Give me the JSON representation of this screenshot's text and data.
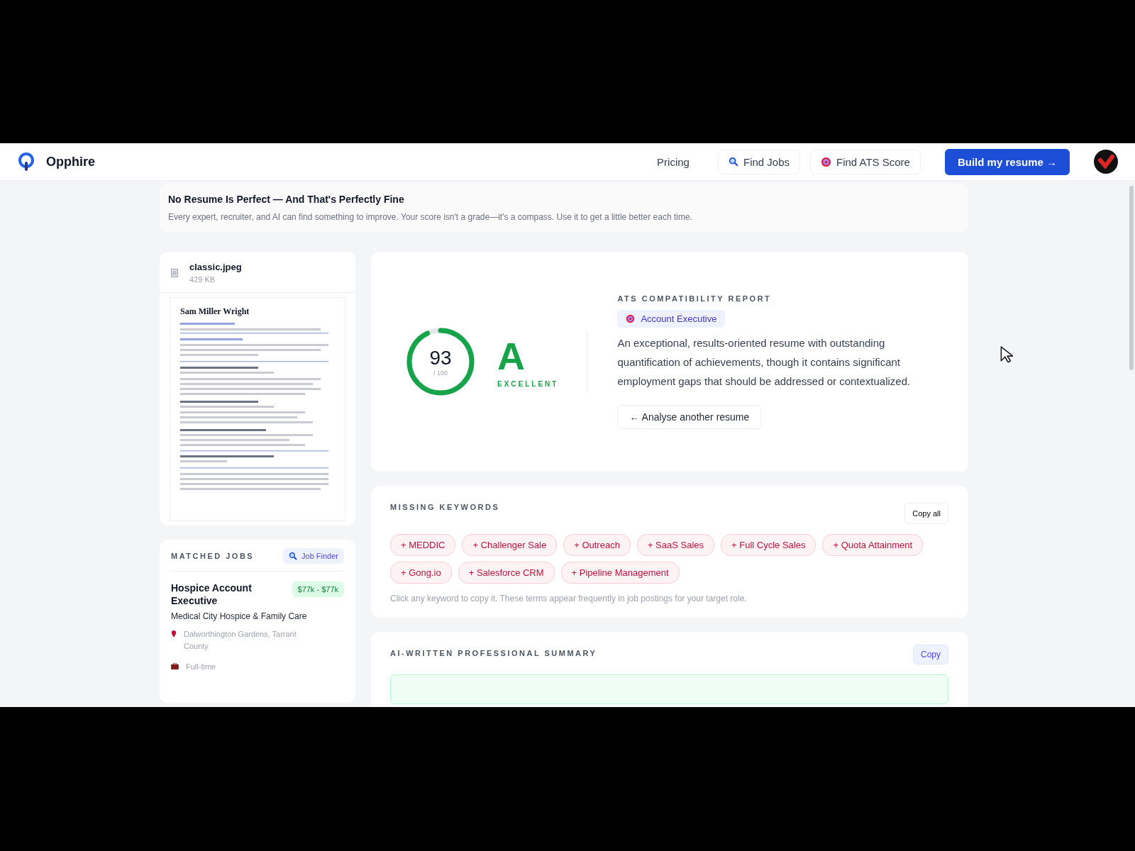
{
  "header": {
    "brand": "Opphire",
    "nav": [
      {
        "kind": "plain",
        "label": "Pricing"
      },
      {
        "kind": "search",
        "label": "Find Jobs"
      },
      {
        "kind": "target",
        "label": "Find ATS Score"
      }
    ],
    "cta": "Build my resume →"
  },
  "banner": {
    "title": "No Resume Is Perfect — And That's Perfectly Fine",
    "text": "Every expert, recruiter, and AI can find something to improve. Your score isn't a grade—it's a compass. Use it to get a little better each time."
  },
  "file": {
    "name": "classic.jpeg",
    "size": "429 KB",
    "preview_name": "Sam Miller Wright"
  },
  "matched_jobs": {
    "title": "MATCHED JOBS",
    "finder": "Job Finder",
    "jobs": [
      {
        "title": "Hospice Account Executive",
        "salary": "$77k - $77k",
        "company": "Medical City Hospice & Family Care",
        "location": "Dalworthington Gardens, Tarrant County",
        "type": "Full-time"
      }
    ]
  },
  "report": {
    "score": "93",
    "out_of": "/ 100",
    "level": 0.93,
    "grade": "A",
    "grade_label": "EXCELLENT",
    "heading": "ATS COMPATIBILITY REPORT",
    "role": "Account Executive",
    "summary": "An exceptional, results-oriented resume with outstanding quantification of achievements, though it contains significant employment gaps that should be addressed or contextualized.",
    "back_button": "← Analyse another resume"
  },
  "missing_keywords": {
    "title": "MISSING KEYWORDS",
    "copy_button": "Copy all",
    "keywords": [
      "+ MEDDIC",
      "+ Challenger Sale",
      "+ Outreach",
      "+ SaaS Sales",
      "+ Full Cycle Sales",
      "+ Quota Attainment",
      "+ Gong.io",
      "+ Salesforce CRM",
      "+ Pipeline Management"
    ],
    "hint": "Click any keyword to copy it. These terms appear frequently in job postings for your target role."
  },
  "ai_summary": {
    "title": "AI-WRITTEN PROFESSIONAL SUMMARY",
    "copy_button": "Copy"
  }
}
